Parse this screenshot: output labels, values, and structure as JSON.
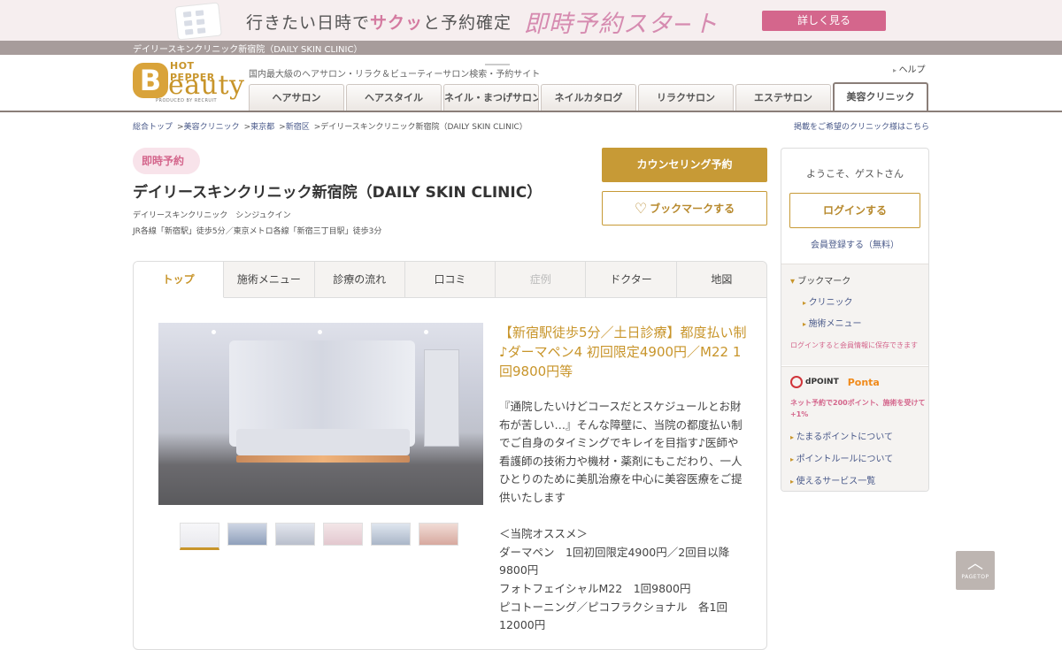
{
  "banner": {
    "text_prefix": "行きたい日時で",
    "text_emph": "サクッ",
    "text_suffix": "と予約確定",
    "headline": "即時予約スタ−ト",
    "button": "詳しく見る"
  },
  "strip_title": "デイリースキンクリニック新宿院（DAILY SKIN CLINIC）",
  "header": {
    "logo_top": "HOT PEPPER",
    "logo_b": "B",
    "logo_word": "eauty",
    "logo_by": "PRODUCED BY RECRUIT",
    "tagline": "国内最大級のヘアサロン・リラク＆ビューティーサロン検索・予約サイト",
    "help": "ヘルプ",
    "nav": [
      "ヘアサロン",
      "ヘアスタイル",
      "ネイル・まつげサロン",
      "ネイルカタログ",
      "リラクサロン",
      "エステサロン",
      "美容クリニック"
    ]
  },
  "breadcrumb": [
    "総合トップ",
    "美容クリニック",
    "東京都",
    "新宿区",
    "デイリースキンクリニック新宿院（DAILY SKIN CLINIC）"
  ],
  "listing_link": "掲載をご希望のクリニック様はこちら",
  "clinic": {
    "badge": "即時予約",
    "name": "デイリースキンクリニック新宿院（DAILY SKIN CLINIC）",
    "kana": "デイリースキンクリニック　シンジュクイン",
    "access": "JR各線「新宿駅」徒歩5分／東京メトロ各線「新宿三丁目駅」徒歩3分"
  },
  "buttons": {
    "counseling": "カウンセリング予約",
    "bookmark": "ブックマークする",
    "heart": "♡"
  },
  "tabs": [
    "トップ",
    "施術メニュー",
    "診療の流れ",
    "口コミ",
    "症例",
    "ドクター",
    "地図"
  ],
  "headline": "【新宿駅徒歩5分／土日診療】都度払い制♪ダーマペン4 初回限定4900円／M22 1回9800円等",
  "body": "『通院したいけどコースだとスケジュールとお財布が苦しい…』そんな障壁に、当院の都度払い制でご自身のタイミングでキレイを目指す♪医師や看護師の技術力や機材・薬剤にもこだわり、一人ひとりのために美肌治療を中心に美容医療をご提供いたします\n\n＜当院オススメ＞\nダーマペン　1回初回限定4900円／2回目以降9800円\nフォトフェイシャルM22　1回9800円\nピコトーニング／ピコフラクショナル　各1回12000円",
  "sidebar": {
    "welcome": "ようこそ、ゲストさん",
    "login": "ログインする",
    "register": "会員登録する（無料）",
    "bookmark_head": "ブックマーク",
    "bookmark_items": [
      "クリニック",
      "施術メニュー"
    ],
    "bookmark_note": "ログインすると会員情報に保存できます",
    "dpoint": "dPOINT",
    "ponta": "Ponta",
    "points_note": "ネット予約で200ポイント、施術を受けて+1%",
    "point_links": [
      "たまるポイントについて",
      "ポイントルールについて",
      "使えるサービス一覧"
    ]
  },
  "pagetop": {
    "arrow": "︿",
    "label": "PAGETOP"
  },
  "colors": {
    "gold": "#c8952b",
    "pink": "#d4668c",
    "link": "#4a5a8a"
  }
}
